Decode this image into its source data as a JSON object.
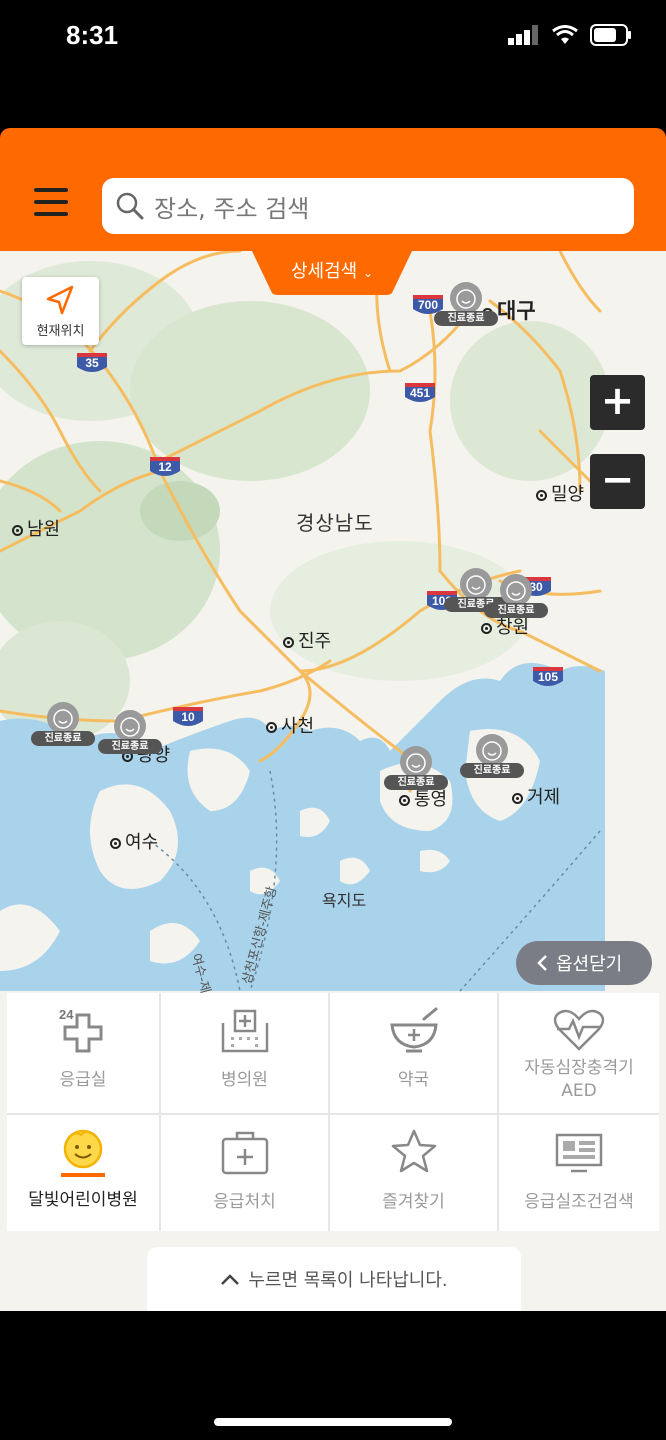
{
  "status": {
    "time": "8:31"
  },
  "header": {
    "search_placeholder": "장소, 주소 검색"
  },
  "map": {
    "detail_search": "상세검색",
    "detail_search_arrow": "⌄",
    "current_location": "현재위치",
    "zoom_in": "+",
    "zoom_out": "−",
    "option_close": "옵션닫기",
    "region": "경상남도",
    "places": {
      "daegu": "대구",
      "miryang": "밀양",
      "namwon": "남원",
      "jinju": "진주",
      "changwon": "창원",
      "sacheon": "사천",
      "gwangyang": "광양",
      "tongyeong": "통영",
      "geoje": "거제",
      "yeosu": "여수",
      "yokjido": "욕지도"
    },
    "ferries": {
      "yeosu_jeju": "여수-제주간",
      "samcheonpo_jeju": "삼천포신항-제주항"
    },
    "markers": [
      "진료종료",
      "진료종료",
      "진료종료",
      "진료종료",
      "진료종료",
      "진료종료",
      "진료종료",
      "진료종료"
    ],
    "routes": [
      "700",
      "35",
      "451",
      "12",
      "102",
      "105",
      "10",
      "30"
    ]
  },
  "grid": {
    "er": "응급실",
    "er_badge": "24",
    "hospital": "병의원",
    "pharmacy": "약국",
    "aed": "자동심장충격기",
    "aed_sub": "AED",
    "moonlight": "달빛어린이병원",
    "firstaid": "응급처치",
    "favorites": "즐겨찾기",
    "er_condition": "응급실조건검색"
  },
  "list_toggle": "누르면 목록이 나타납니다.",
  "colors": {
    "brand": "#ff6a00",
    "map_water": "#a9d3ea",
    "map_land": "#f4f3ee",
    "road": "#f6bd60"
  }
}
